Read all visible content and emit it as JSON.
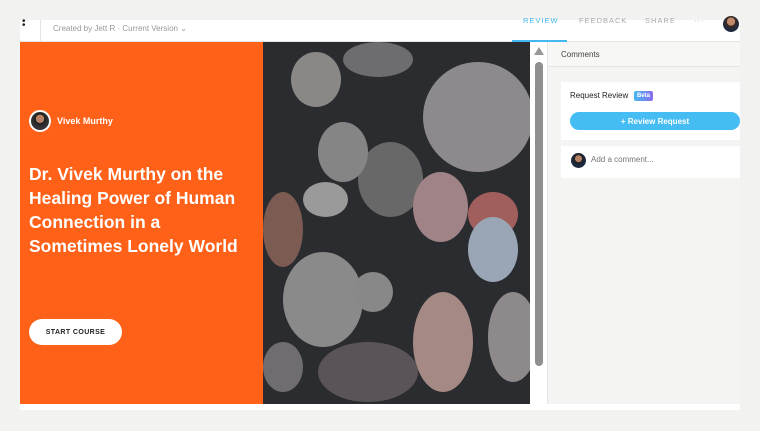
{
  "header": {
    "created_by": "Created by Jett R",
    "separator": "·",
    "version": "Current Version ⌄",
    "tabs": [
      "REVIEW",
      "FEEDBACK",
      "SHARE",
      "···"
    ]
  },
  "course": {
    "author": "Vivek Murthy",
    "title": "Dr. Vivek Murthy on the Healing Power of Human Connection in a Sometimes Lonely World",
    "start_label": "START COURSE",
    "accent": "#ff6119"
  },
  "panel": {
    "heading": "Comments",
    "request_review": "Request Review",
    "beta": "Beta",
    "review_button": "+ Review Request",
    "comment_placeholder": "Add a comment..."
  }
}
